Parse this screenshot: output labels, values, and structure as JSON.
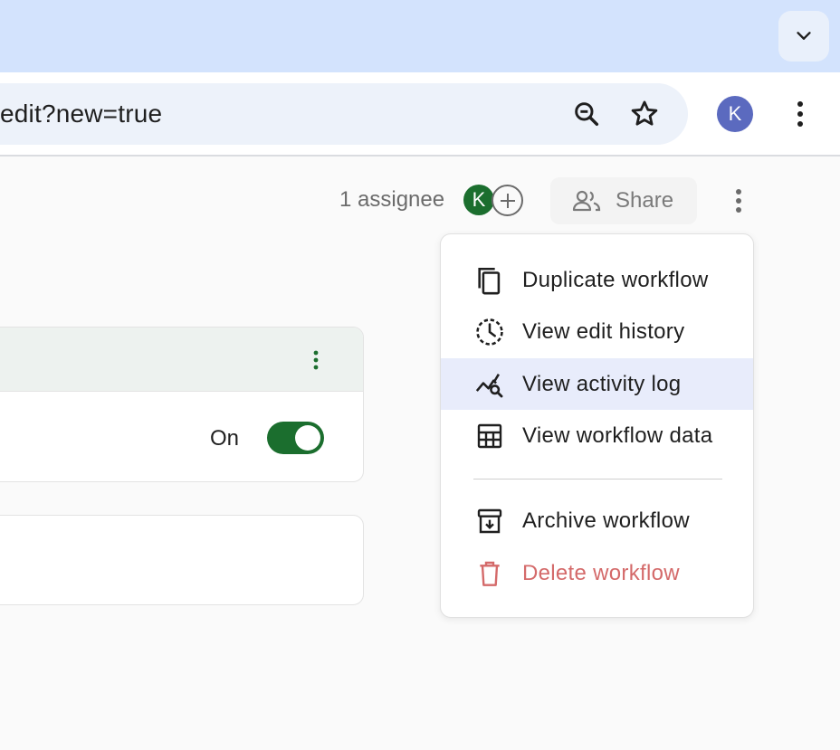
{
  "browser": {
    "url_text": "edit?new=true",
    "profile_initial": "K",
    "icons": [
      "chevron-down-icon",
      "zoom-out-icon",
      "star-icon",
      "more-vert-icon"
    ]
  },
  "header": {
    "assignee_count": "1 assignee",
    "assignee_initial": "K",
    "share_label": "Share"
  },
  "card": {
    "status_label": "On",
    "toggle_on": true
  },
  "menu": {
    "items": [
      {
        "label": "Duplicate workflow",
        "icon": "copy-icon"
      },
      {
        "label": "View edit history",
        "icon": "history-icon"
      },
      {
        "label": "View activity log",
        "icon": "activity-log-icon"
      },
      {
        "label": "View workflow data",
        "icon": "table-icon"
      },
      {
        "label": "Archive workflow",
        "icon": "archive-icon"
      },
      {
        "label": "Delete workflow",
        "icon": "trash-icon"
      }
    ]
  },
  "colors": {
    "tabstrip": "#d3e3fd",
    "accent_green": "#1b6e2e",
    "avatar_purple": "#5b6abf",
    "danger": "#d46a6a",
    "menu_highlight": "#e8ecfb"
  }
}
